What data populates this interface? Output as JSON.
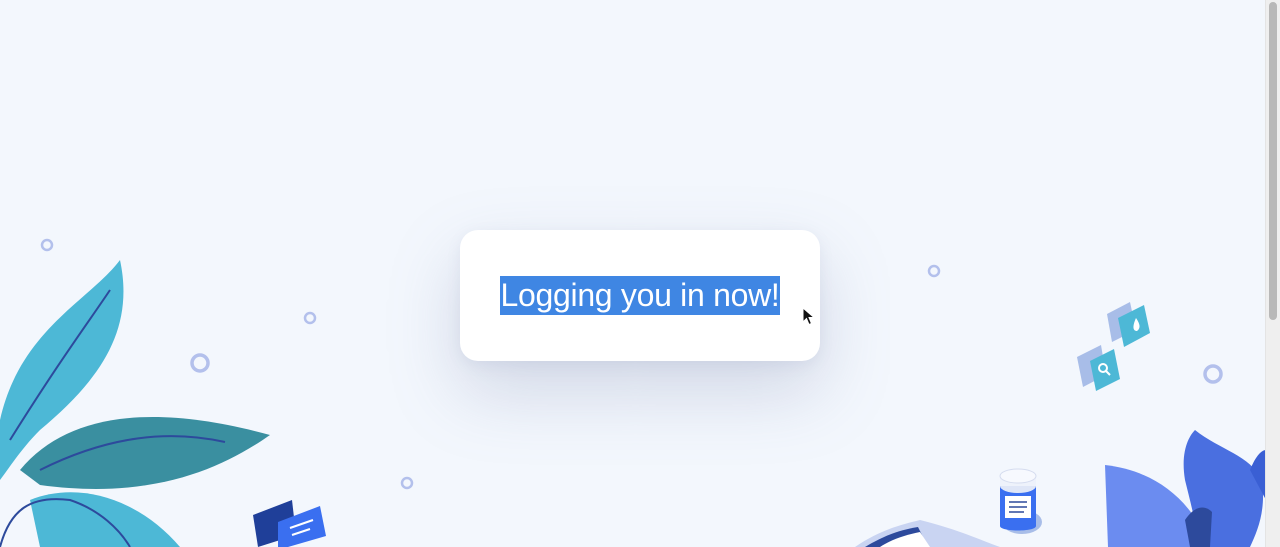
{
  "loading_card": {
    "message": "Logging you in now!"
  },
  "icons": {
    "background_decoration": "medical-illustration",
    "cursor": "mouse-pointer-icon"
  },
  "colors": {
    "background": "#f3f7fd",
    "card": "#ffffff",
    "text_selection": "#3f86e3",
    "leaf_light": "#4db8d6",
    "leaf_dark": "#3a8fa0",
    "accent_blue": "#4a6fe0"
  }
}
